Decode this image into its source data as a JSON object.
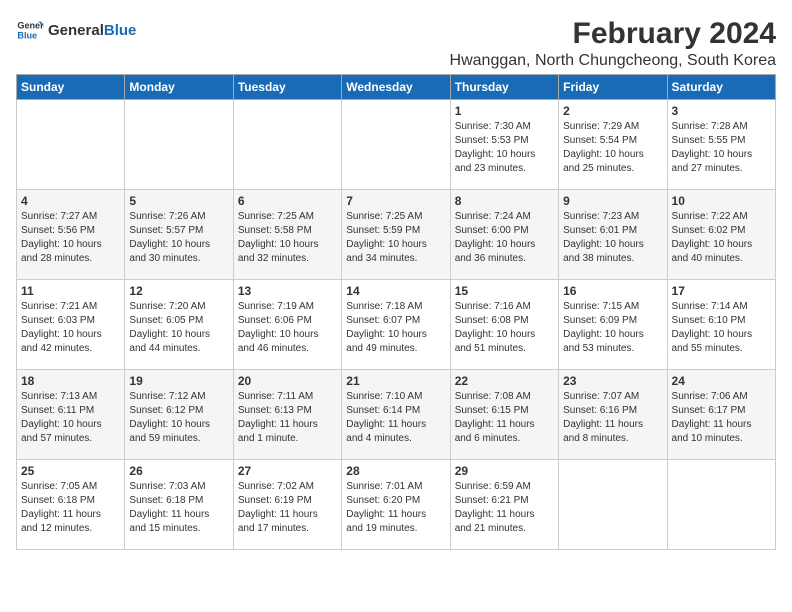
{
  "logo": {
    "text_general": "General",
    "text_blue": "Blue"
  },
  "main_title": "February 2024",
  "subtitle": "Hwanggan, North Chungcheong, South Korea",
  "days_header": [
    "Sunday",
    "Monday",
    "Tuesday",
    "Wednesday",
    "Thursday",
    "Friday",
    "Saturday"
  ],
  "weeks": [
    [
      {
        "day": "",
        "info": ""
      },
      {
        "day": "",
        "info": ""
      },
      {
        "day": "",
        "info": ""
      },
      {
        "day": "",
        "info": ""
      },
      {
        "day": "1",
        "info": "Sunrise: 7:30 AM\nSunset: 5:53 PM\nDaylight: 10 hours\nand 23 minutes."
      },
      {
        "day": "2",
        "info": "Sunrise: 7:29 AM\nSunset: 5:54 PM\nDaylight: 10 hours\nand 25 minutes."
      },
      {
        "day": "3",
        "info": "Sunrise: 7:28 AM\nSunset: 5:55 PM\nDaylight: 10 hours\nand 27 minutes."
      }
    ],
    [
      {
        "day": "4",
        "info": "Sunrise: 7:27 AM\nSunset: 5:56 PM\nDaylight: 10 hours\nand 28 minutes."
      },
      {
        "day": "5",
        "info": "Sunrise: 7:26 AM\nSunset: 5:57 PM\nDaylight: 10 hours\nand 30 minutes."
      },
      {
        "day": "6",
        "info": "Sunrise: 7:25 AM\nSunset: 5:58 PM\nDaylight: 10 hours\nand 32 minutes."
      },
      {
        "day": "7",
        "info": "Sunrise: 7:25 AM\nSunset: 5:59 PM\nDaylight: 10 hours\nand 34 minutes."
      },
      {
        "day": "8",
        "info": "Sunrise: 7:24 AM\nSunset: 6:00 PM\nDaylight: 10 hours\nand 36 minutes."
      },
      {
        "day": "9",
        "info": "Sunrise: 7:23 AM\nSunset: 6:01 PM\nDaylight: 10 hours\nand 38 minutes."
      },
      {
        "day": "10",
        "info": "Sunrise: 7:22 AM\nSunset: 6:02 PM\nDaylight: 10 hours\nand 40 minutes."
      }
    ],
    [
      {
        "day": "11",
        "info": "Sunrise: 7:21 AM\nSunset: 6:03 PM\nDaylight: 10 hours\nand 42 minutes."
      },
      {
        "day": "12",
        "info": "Sunrise: 7:20 AM\nSunset: 6:05 PM\nDaylight: 10 hours\nand 44 minutes."
      },
      {
        "day": "13",
        "info": "Sunrise: 7:19 AM\nSunset: 6:06 PM\nDaylight: 10 hours\nand 46 minutes."
      },
      {
        "day": "14",
        "info": "Sunrise: 7:18 AM\nSunset: 6:07 PM\nDaylight: 10 hours\nand 49 minutes."
      },
      {
        "day": "15",
        "info": "Sunrise: 7:16 AM\nSunset: 6:08 PM\nDaylight: 10 hours\nand 51 minutes."
      },
      {
        "day": "16",
        "info": "Sunrise: 7:15 AM\nSunset: 6:09 PM\nDaylight: 10 hours\nand 53 minutes."
      },
      {
        "day": "17",
        "info": "Sunrise: 7:14 AM\nSunset: 6:10 PM\nDaylight: 10 hours\nand 55 minutes."
      }
    ],
    [
      {
        "day": "18",
        "info": "Sunrise: 7:13 AM\nSunset: 6:11 PM\nDaylight: 10 hours\nand 57 minutes."
      },
      {
        "day": "19",
        "info": "Sunrise: 7:12 AM\nSunset: 6:12 PM\nDaylight: 10 hours\nand 59 minutes."
      },
      {
        "day": "20",
        "info": "Sunrise: 7:11 AM\nSunset: 6:13 PM\nDaylight: 11 hours\nand 1 minute."
      },
      {
        "day": "21",
        "info": "Sunrise: 7:10 AM\nSunset: 6:14 PM\nDaylight: 11 hours\nand 4 minutes."
      },
      {
        "day": "22",
        "info": "Sunrise: 7:08 AM\nSunset: 6:15 PM\nDaylight: 11 hours\nand 6 minutes."
      },
      {
        "day": "23",
        "info": "Sunrise: 7:07 AM\nSunset: 6:16 PM\nDaylight: 11 hours\nand 8 minutes."
      },
      {
        "day": "24",
        "info": "Sunrise: 7:06 AM\nSunset: 6:17 PM\nDaylight: 11 hours\nand 10 minutes."
      }
    ],
    [
      {
        "day": "25",
        "info": "Sunrise: 7:05 AM\nSunset: 6:18 PM\nDaylight: 11 hours\nand 12 minutes."
      },
      {
        "day": "26",
        "info": "Sunrise: 7:03 AM\nSunset: 6:18 PM\nDaylight: 11 hours\nand 15 minutes."
      },
      {
        "day": "27",
        "info": "Sunrise: 7:02 AM\nSunset: 6:19 PM\nDaylight: 11 hours\nand 17 minutes."
      },
      {
        "day": "28",
        "info": "Sunrise: 7:01 AM\nSunset: 6:20 PM\nDaylight: 11 hours\nand 19 minutes."
      },
      {
        "day": "29",
        "info": "Sunrise: 6:59 AM\nSunset: 6:21 PM\nDaylight: 11 hours\nand 21 minutes."
      },
      {
        "day": "",
        "info": ""
      },
      {
        "day": "",
        "info": ""
      }
    ]
  ]
}
